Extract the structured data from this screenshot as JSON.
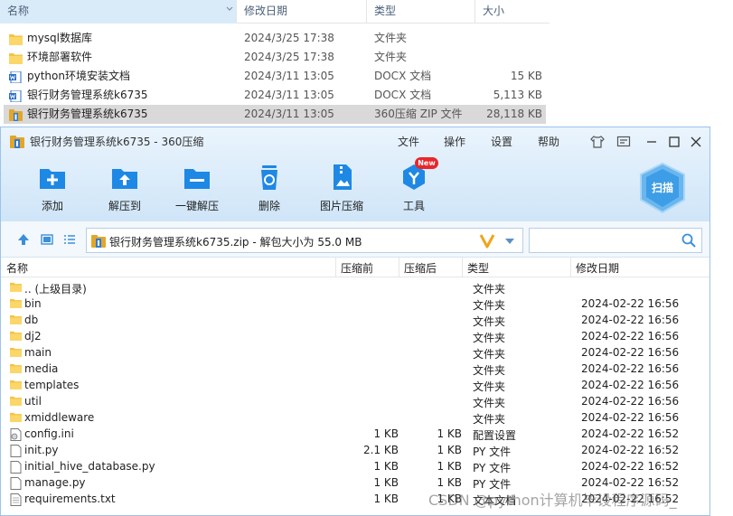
{
  "explorer": {
    "columns": [
      "名称",
      "修改日期",
      "类型",
      "大小"
    ],
    "rows": [
      {
        "icon": "folder-icon",
        "name": "mysql数据库",
        "date": "2024/3/25 17:38",
        "type": "文件夹",
        "size": ""
      },
      {
        "icon": "folder-icon",
        "name": "环境部署软件",
        "date": "2024/3/25 17:38",
        "type": "文件夹",
        "size": ""
      },
      {
        "icon": "word-doc-icon",
        "name": "python环境安装文档",
        "date": "2024/3/11 13:05",
        "type": "DOCX 文档",
        "size": "15 KB"
      },
      {
        "icon": "word-doc-icon",
        "name": "银行财务管理系统k6735",
        "date": "2024/3/11 13:05",
        "type": "DOCX 文档",
        "size": "5,113 KB"
      },
      {
        "icon": "zip-archive-icon",
        "name": "银行财务管理系统k6735",
        "date": "2024/3/11 13:05",
        "type": "360压缩 ZIP 文件",
        "size": "28,118 KB"
      }
    ]
  },
  "zip": {
    "title": "银行财务管理系统k6735 - 360压缩",
    "menu": [
      "文件",
      "操作",
      "设置",
      "帮助"
    ],
    "toolbar": [
      {
        "label": "添加",
        "icon": "add-icon"
      },
      {
        "label": "解压到",
        "icon": "extract-to-icon"
      },
      {
        "label": "一键解压",
        "icon": "one-click-extract-icon"
      },
      {
        "label": "删除",
        "icon": "delete-icon"
      },
      {
        "label": "图片压缩",
        "icon": "image-compress-icon"
      },
      {
        "label": "工具",
        "icon": "tools-icon"
      }
    ],
    "new_badge": "New",
    "scan_label": "扫描",
    "address": "银行财务管理系统k6735.zip - 解包大小为 55.0 MB",
    "search_placeholder": "",
    "columns": {
      "name": "名称",
      "compressed": "压缩前",
      "uncompressed": "压缩后",
      "type": "类型",
      "modified": "修改日期"
    },
    "files": [
      {
        "icon": "folder-icon",
        "name": ".. (上级目录)",
        "compressed": "",
        "uncompressed": "",
        "type": "文件夹",
        "modified": ""
      },
      {
        "icon": "folder-icon",
        "name": "bin",
        "compressed": "",
        "uncompressed": "",
        "type": "文件夹",
        "modified": "2024-02-22 16:56"
      },
      {
        "icon": "folder-icon",
        "name": "db",
        "compressed": "",
        "uncompressed": "",
        "type": "文件夹",
        "modified": "2024-02-22 16:56"
      },
      {
        "icon": "folder-icon",
        "name": "dj2",
        "compressed": "",
        "uncompressed": "",
        "type": "文件夹",
        "modified": "2024-02-22 16:56"
      },
      {
        "icon": "folder-icon",
        "name": "main",
        "compressed": "",
        "uncompressed": "",
        "type": "文件夹",
        "modified": "2024-02-22 16:56"
      },
      {
        "icon": "folder-icon",
        "name": "media",
        "compressed": "",
        "uncompressed": "",
        "type": "文件夹",
        "modified": "2024-02-22 16:56"
      },
      {
        "icon": "folder-icon",
        "name": "templates",
        "compressed": "",
        "uncompressed": "",
        "type": "文件夹",
        "modified": "2024-02-22 16:56"
      },
      {
        "icon": "folder-icon",
        "name": "util",
        "compressed": "",
        "uncompressed": "",
        "type": "文件夹",
        "modified": "2024-02-22 16:56"
      },
      {
        "icon": "folder-icon",
        "name": "xmiddleware",
        "compressed": "",
        "uncompressed": "",
        "type": "文件夹",
        "modified": "2024-02-22 16:56"
      },
      {
        "icon": "config-file-icon",
        "name": "config.ini",
        "compressed": "1 KB",
        "uncompressed": "1 KB",
        "type": "配置设置",
        "modified": "2024-02-22 16:52"
      },
      {
        "icon": "file-icon",
        "name": "init.py",
        "compressed": "2.1 KB",
        "uncompressed": "1 KB",
        "type": "PY 文件",
        "modified": "2024-02-22 16:52"
      },
      {
        "icon": "file-icon",
        "name": "initial_hive_database.py",
        "compressed": "1 KB",
        "uncompressed": "1 KB",
        "type": "PY 文件",
        "modified": "2024-02-22 16:52"
      },
      {
        "icon": "file-icon",
        "name": "manage.py",
        "compressed": "1 KB",
        "uncompressed": "1 KB",
        "type": "PY 文件",
        "modified": "2024-02-22 16:52"
      },
      {
        "icon": "text-file-icon",
        "name": "requirements.txt",
        "compressed": "1 KB",
        "uncompressed": "1 KB",
        "type": "文本文档",
        "modified": "2024-02-22 16:52"
      }
    ]
  },
  "watermark": "CSDN @python计算机毕设程序源码_",
  "colors": {
    "accent": "#1e88e5",
    "titlebar_top": "#eaf4fd",
    "titlebar_bottom": "#cfe5f8",
    "selection": "#d9d9d9",
    "header_sort": "#d9ebf9"
  }
}
